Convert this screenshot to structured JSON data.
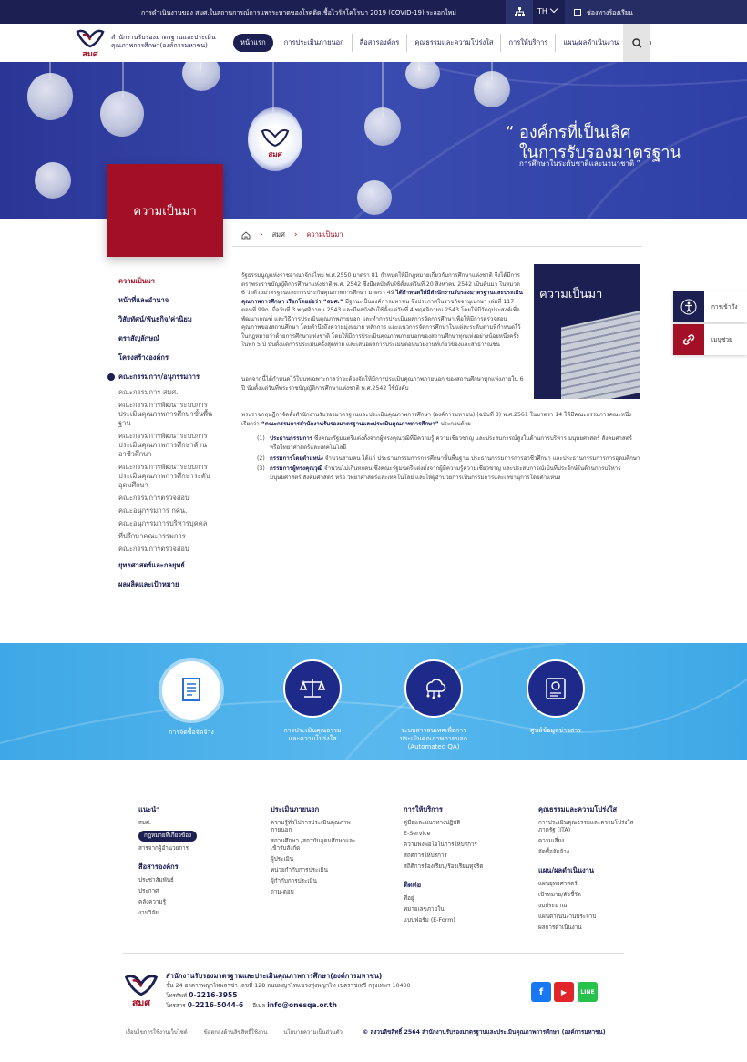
{
  "topbar": {
    "notice": "การดำเนินงานของ สมศ.ในสถานการณ์การแพร่ระบาดของโรคติดเชื้อไวรัสโคโรนา 2019 (COVID-19) ระลอกใหม่",
    "lang": "TH",
    "contact": "ช่องทางร้องเรียน"
  },
  "header": {
    "logo_text": "สมศ",
    "org_line1": "สำนักงานรับรองมาตรฐานและประเมิน",
    "org_line2": "คุณภาพการศึกษา(องค์การมหาชน)",
    "nav": [
      "หน้าแรก",
      "การประเมินภายนอก",
      "สื่อสารองค์กร",
      "คุณธรรมและความโปร่งใส",
      "การให้บริการ",
      "แผน/ผลดำเนินงาน",
      "ติดต่อ"
    ]
  },
  "hero": {
    "line1": "“ องค์กรที่เป็นเลิศ",
    "line2": "ในการรับรองมาตรฐาน",
    "line3": "การศึกษาในระดับชาติและนานาชาติ ”",
    "logo_text": "สมศ"
  },
  "page": {
    "title": "ความเป็นมา",
    "breadcrumb": [
      "สมศ",
      "ความเป็นมา"
    ]
  },
  "sidebar": {
    "main_top": [
      "ความเป็นมา",
      "หน้าที่และอำนาจ",
      "วิสัยทัศน์/พันธกิจ/ค่านิยม",
      "ตราสัญลักษณ์",
      "โครงสร้างองค์กร",
      "คณะกรรมการ/อนุกรรมการ"
    ],
    "sub": [
      "คณะกรรมการ สมศ.",
      "คณะกรรมการพัฒนาระบบการประเมินคุณภาพการศึกษาขั้นพื้นฐาน",
      "คณะกรรมการพัฒนาระบบการประเมินคุณภาพการศึกษาด้านอาชีวศึกษา",
      "คณะกรรมการพัฒนาระบบการประเมินคุณภาพการศึกษาระดับอุดมศึกษา",
      "คณะกรรมการตรวจสอบ",
      "คณะอนุกรรมการ กคน.",
      "คณะอนุกรรมการบริหารบุคคล",
      "ที่ปรึกษาคณะกรรมการ",
      "คณะกรรมการตรวจสอบ"
    ],
    "main_bottom": [
      "ยุทธศาสตร์และกลยุทธ์",
      "ผลผลิตและเป้าหมาย"
    ]
  },
  "content": {
    "cover_title": "ความเป็นมา",
    "para1_a": "รัฐธรรมนูญแห่งราชอาณาจักรไทย พ.ศ.2550 มาตรา 81 กำหนดให้มีกฎหมายเกี่ยวกับการศึกษาแห่งชาติ จึงได้มีการตราพระราชบัญญัติการศึกษาแห่งชาติ พ.ศ. 2542 ซึ่งมีผลบังคับใช้ตั้งแต่วันที่ 20 สิงหาคม 2542 เป็นต้นมา ในหมวด 6 ว่าด้วยมาตรฐานและการประกันคุณภาพการศึกษา มาตรา 49",
    "para1_b": "ได้กำหนดให้มีสำนักงานรับรองมาตรฐานและประเมินคุณภาพการศึกษา เรียกโดยย่อว่า “สมศ.”",
    "para1_c": "มีฐานะเป็นองค์การมหาชน ซึ่งประกาศในราชกิจจานุเบกษา เล่มที่ 117 ตอนที่ 99ก เมื่อวันที่ 3 พฤศจิกายน 2543 และมีผลบังคับใช้ตั้งแต่วันที่ 4 พฤศจิกายน 2543 โดยให้มีวัตถุประสงค์เพื่อพัฒนาเกณฑ์ และวิธีการประเมินคุณภาพภายนอก และทำการประเมินผลการจัดการศึกษาเพื่อให้มีการตรวจสอบคุณภาพของสถานศึกษา โดยคำนึงถึงความมุ่งหมาย หลักการ และแนวการจัดการศึกษาในแต่ละระดับตามที่กำหนดไว้ในกฎหมายว่าด้วยการศึกษาแห่งชาติ โดยให้มีการประเมินคุณภาพภายนอกของสถานศึกษาทุกแห่งอย่างน้อยหนึ่งครั้งในทุก 5 ปี นับตั้งแต่การประเมินครั้งสุดท้าย และเสนอผลการประเมินต่อหน่วยงานที่เกี่ยวข้องและสาธารณชน",
    "para2": "นอกจากนี้ได้กำหนดไว้ในบทเฉพาะกาลว่าจะต้องจัดให้มีการประเมินคุณภาพภายนอก ของสถานศึกษาทุกแห่งภายใน 6 ปี นับตั้งแต่วันที่พระราชบัญญัติการศึกษาแห่งชาติ พ.ศ.2542 ใช้บังคับ",
    "para3_a": "พระราชกฤษฎีกาจัดตั้งสำนักงานรับรองมาตรฐานและประเมินคุณภาพการศึกษา (องค์การมหาชน) (ฉบับที่ 3) พ.ศ.2561 ในมาตรา 14 ให้มีคณะกรรมการคณะหนึ่ง เรียกว่า",
    "para3_b": "“คณะกรรมการสำนักงานรับรองมาตรฐานและประเมินคุณภาพการศึกษา”",
    "para3_c": "ประกอบด้วย",
    "list": [
      {
        "num": "(1)",
        "head": "ประธานกรรมการ",
        "text": "ซึ่งคณะรัฐมนตรีแต่งตั้งจากผู้ทรงคุณวุฒิที่มีความรู้ ความเชี่ยวชาญ และประสบการณ์สูงในด้านการบริหาร มนุษยศาสตร์ สังคมศาสตร์ หรือวิทยาศาสตร์และเทคโนโลยี"
      },
      {
        "num": "(2)",
        "head": "กรรมการโดยตำแหน่ง",
        "text": "จำนวนสามคน ได้แก่ ประธานกรรมการการศึกษาขั้นพื้นฐาน ประธานกรรมการการอาชีวศึกษา และประธานกรรมการการอุดมศึกษา"
      },
      {
        "num": "(3)",
        "head": "กรรมการผู้ทรงคุณวุฒิ",
        "text": "จำนวนไม่เกินหกคน ซึ่งคณะรัฐมนตรีแต่งตั้งจากผู้มีความรู้ความเชี่ยวชาญ และประสบการณ์เป็นที่ประจักษ์ในด้านการบริหาร มนุษยศาสตร์ สังคมศาสตร์ หรือ วิทยาศาสตร์และเทคโนโลยี และให้ผู้อำนวยการเป็นกรรมการและเลขานุการโดยตำแหน่ง"
      }
    ]
  },
  "floating": {
    "access": "การเข้าถึง",
    "help": "เมนูช่วย"
  },
  "services": [
    {
      "label1": "การจัดซื้อจัดจ้าง",
      "label2": ""
    },
    {
      "label1": "การประเมินคุณธรรม",
      "label2": "และความโปร่งใส"
    },
    {
      "label1": "ระบบสารสนเทศเพื่อการ",
      "label2": "ประเมินคุณภาพภายนอก",
      "label3": "(Automated QA)"
    },
    {
      "label1": "ศูนย์ข้อมูลข่าวสาร",
      "label2": ""
    }
  ],
  "footer": {
    "col1": {
      "h1": "แนะนำ",
      "items1": [
        "สมศ.",
        "กฎหมายที่เกี่ยวข้อง",
        "สารจากผู้อำนวยการ"
      ],
      "h2": "สื่อสารองค์กร",
      "items2": [
        "ประชาสัมพันธ์",
        "ประกาศ",
        "คลังความรู้",
        "งานวิจัย"
      ]
    },
    "col2": {
      "h1": "ประเมินภายนอก",
      "items1": [
        "ความรู้ทั่วไปการประเมินคุณภาพภายนอก",
        "สถานศึกษา /สถาบันอุดมศึกษาและเข้ารับสังกัด",
        "ผู้ประเมิน",
        "หน่วยกำกับการประเมิน",
        "ผู้กำกับการประเมิน",
        "ถาม-ตอบ"
      ]
    },
    "col3": {
      "h1": "การให้บริการ",
      "items1": [
        "คู่มือและแนวทางปฏิบัติ",
        "E-Service",
        "ความพึงพอใจในการให้บริการ",
        "สถิติการให้บริการ",
        "สถิติการร้องเรียน/ร้องเรียนทุจริต"
      ],
      "h2": "ติดต่อ",
      "items2": [
        "ที่อยู่",
        "หมายเลขภายใน",
        "แบบฟอร์ม (E-Form)"
      ]
    },
    "col4": {
      "h1": "คุณธรรมและความโปร่งใส",
      "items1": [
        "การประเมินคุณธรรมและความโปร่งใสภาครัฐ (ITA)",
        "ความเสี่ยง",
        "จัดซื้อจัดจ้าง"
      ],
      "h2": "แผน/ผลดำเนินงาน",
      "items2": [
        "แผนยุทธศาสตร์",
        "เป้าหมาย/ตัวชี้วัด",
        "งบประมาณ",
        "แผนดำเนินงานประจำปี",
        "ผลการดำเนินงาน"
      ]
    },
    "address": {
      "name": "สำนักงานรับรองมาตรฐานและประเมินคุณภาพการศึกษา(องค์การมหาชน)",
      "line": "ชั้น 24 อาคารพญาไทพลาซ่า เลขที่ 128 ถนนพญาไทแขวงทุ่งพญาไท เขตราชเทวี กรุงเทพฯ 10400",
      "tel_label": "โทรศัพท์",
      "tel": "0-2216-3955",
      "fax_label": "โทรสาร",
      "fax": "0-2216-5044-6",
      "email_label": "อีเมล",
      "email": "info@onesqa.or.th"
    },
    "bottom_links": [
      "เงื่อนไขการใช้งานเว็บไซต์",
      "ข้อตกลงด้านลิขสิทธิ์ใช้งาน",
      "นโยบายความเป็นส่วนตัว"
    ],
    "copyright": "© สงวนลิขสิทธิ์ 2564 สำนักงานรับรองมาตรฐานและประเมินคุณภาพการศึกษา (องค์การมหาชน)",
    "social": [
      "f",
      "▶",
      "LINE"
    ]
  },
  "colors": {
    "navy": "#1b1f52",
    "red": "#a30f24",
    "sky": "#3ea8e6"
  }
}
